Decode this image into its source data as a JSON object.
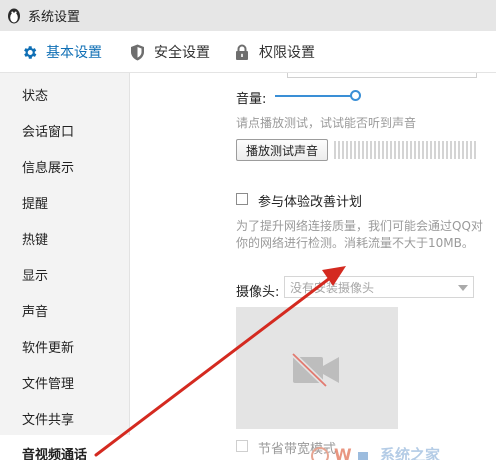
{
  "window": {
    "title": "系统设置"
  },
  "tabs": [
    {
      "label": "基本设置",
      "icon": "gear-icon",
      "active": true
    },
    {
      "label": "安全设置",
      "icon": "shield-icon",
      "active": false
    },
    {
      "label": "权限设置",
      "icon": "lock-icon",
      "active": false
    }
  ],
  "sidebar": {
    "items": [
      {
        "label": "状态"
      },
      {
        "label": "会话窗口"
      },
      {
        "label": "信息展示"
      },
      {
        "label": "提醒"
      },
      {
        "label": "热键"
      },
      {
        "label": "显示"
      },
      {
        "label": "声音"
      },
      {
        "label": "软件更新"
      },
      {
        "label": "文件管理"
      },
      {
        "label": "文件共享"
      },
      {
        "label": "音视频通话",
        "active": true
      }
    ]
  },
  "audio": {
    "volume_label": "音量:",
    "volume_level": 0.95,
    "test_hint": "请点播放测试，试试能否听到声音",
    "play_test_button": "播放测试声音"
  },
  "experience": {
    "checkbox_label": "参与体验改善计划",
    "checked": false,
    "desc_line1": "为了提升网络连接质量，我们可能会通过QQ对",
    "desc_line2": "你的网络进行检测。消耗流量不大于10MB。"
  },
  "camera": {
    "label": "摄像头:",
    "select_value": "没有安装摄像头"
  },
  "bandwidth": {
    "checkbox_label": "节省带宽模式",
    "checked": false
  },
  "colors": {
    "accent": "#0f6fb5",
    "slider": "#3a8fd6",
    "annotation_arrow": "#d42a20"
  }
}
